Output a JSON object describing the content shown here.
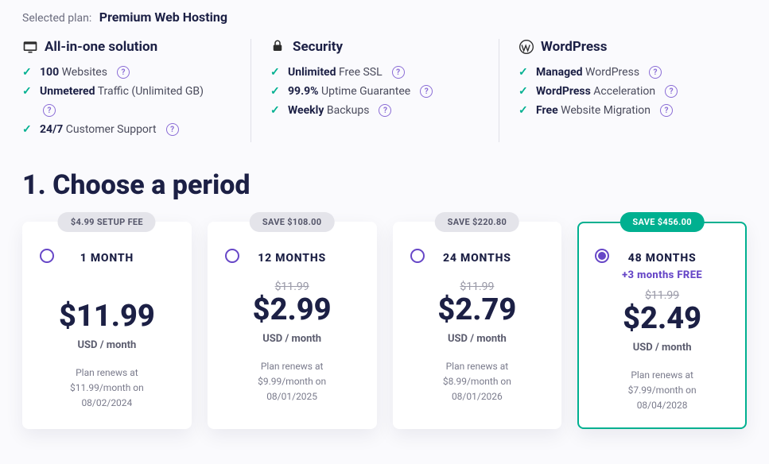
{
  "header": {
    "selected_plan_label": "Selected plan:",
    "selected_plan_name": "Premium Web Hosting"
  },
  "feature_groups": [
    {
      "icon": "all-in-one-icon",
      "title": "All-in-one solution",
      "items": [
        {
          "bold": "100",
          "rest": "Websites",
          "help": true
        },
        {
          "bold": "Unmetered",
          "rest": "Traffic (Unlimited GB)",
          "help": true,
          "help_below": true
        },
        {
          "bold": "24/7",
          "rest": "Customer Support",
          "help": true
        }
      ]
    },
    {
      "icon": "lock-icon",
      "title": "Security",
      "items": [
        {
          "bold": "Unlimited",
          "rest": "Free SSL",
          "help": true
        },
        {
          "bold": "99.9%",
          "rest": "Uptime Guarantee",
          "help": true
        },
        {
          "bold": "Weekly",
          "rest": "Backups",
          "help": true
        }
      ]
    },
    {
      "icon": "wordpress-icon",
      "title": "WordPress",
      "items": [
        {
          "bold": "Managed",
          "rest": "WordPress",
          "help": true
        },
        {
          "bold": "WordPress",
          "rest": "Acceleration",
          "help": true
        },
        {
          "bold": "Free",
          "rest": "Website Migration",
          "help": true
        }
      ]
    }
  ],
  "section_title": "1. Choose a period",
  "period_unit": "USD / month",
  "periods": [
    {
      "pill": "$4.99 SETUP FEE",
      "pill_green": false,
      "label": "1 MONTH",
      "bonus": "",
      "old_price": "",
      "price": "$11.99",
      "renew_line1": "Plan renews at",
      "renew_line2": "$11.99/month on",
      "renew_line3": "08/02/2024",
      "selected": false
    },
    {
      "pill": "SAVE $108.00",
      "pill_green": false,
      "label": "12 MONTHS",
      "bonus": "",
      "old_price": "$11.99",
      "price": "$2.99",
      "renew_line1": "Plan renews at",
      "renew_line2": "$9.99/month on",
      "renew_line3": "08/01/2025",
      "selected": false
    },
    {
      "pill": "SAVE $220.80",
      "pill_green": false,
      "label": "24 MONTHS",
      "bonus": "",
      "old_price": "$11.99",
      "price": "$2.79",
      "renew_line1": "Plan renews at",
      "renew_line2": "$8.99/month on",
      "renew_line3": "08/01/2026",
      "selected": false
    },
    {
      "pill": "SAVE $456.00",
      "pill_green": true,
      "label": "48 MONTHS",
      "bonus": "+3 months FREE",
      "old_price": "$11.99",
      "price": "$2.49",
      "renew_line1": "Plan renews at",
      "renew_line2": "$7.99/month on",
      "renew_line3": "08/04/2028",
      "selected": true
    }
  ]
}
